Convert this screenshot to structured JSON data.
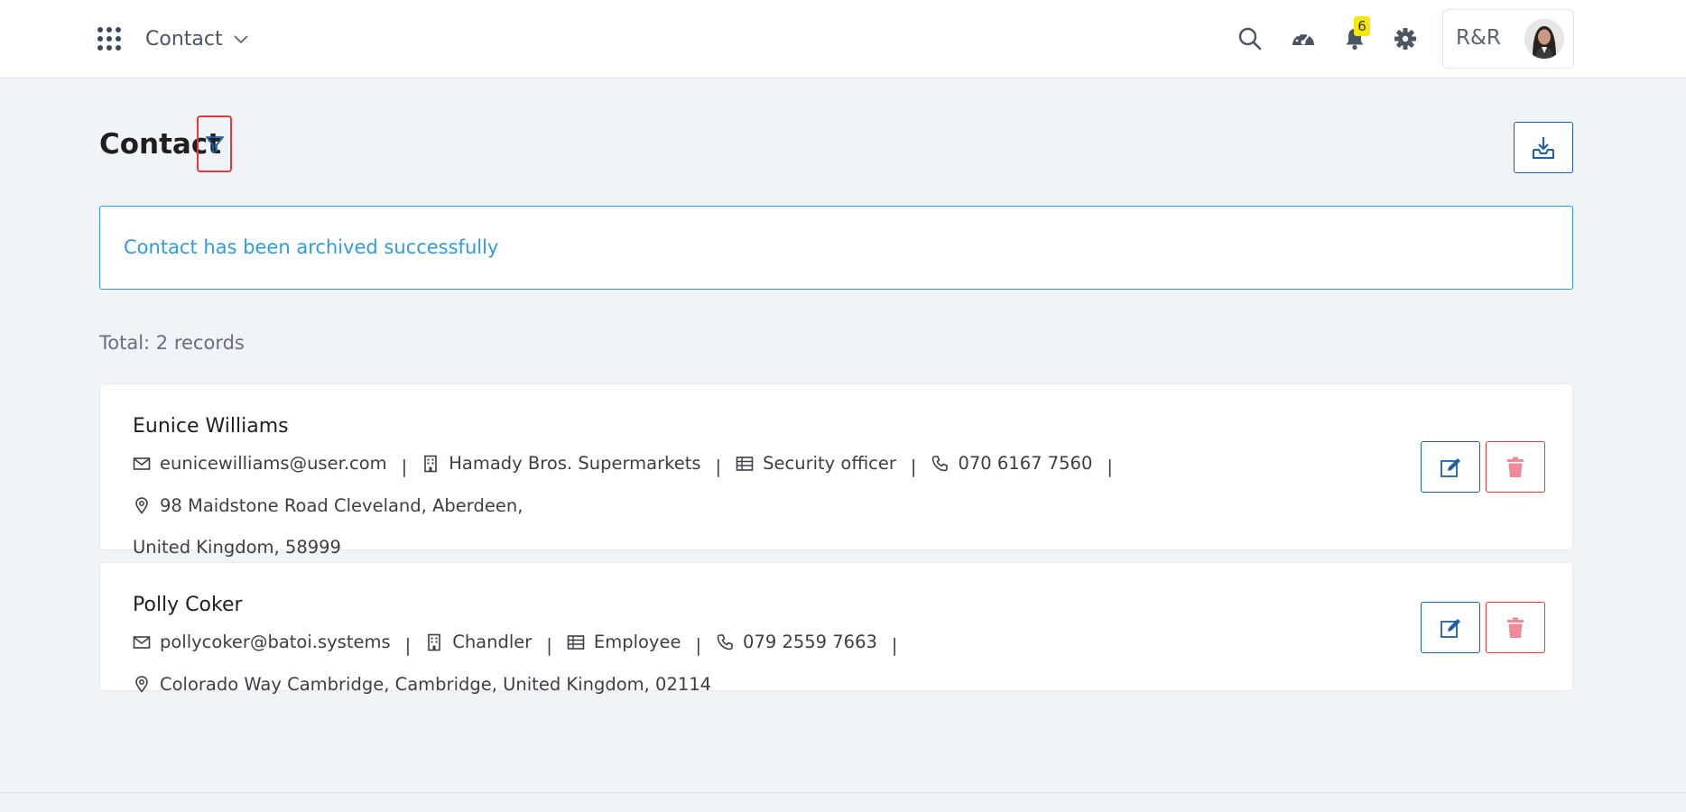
{
  "header": {
    "module_label": "Contact",
    "notification_count": "6",
    "org_label": "R&R"
  },
  "page": {
    "title": "Contact"
  },
  "alert": {
    "message": "Contact has been archived successfully"
  },
  "total_label": "Total: 2 records",
  "contacts": [
    {
      "name": "Eunice Williams",
      "email": "eunicewilliams@user.com",
      "company": "Hamady Bros. Supermarkets",
      "position": "Security officer",
      "phone": "070 6167 7560",
      "address_line1": "98 Maidstone Road Cleveland, Aberdeen,",
      "address_line2": "United Kingdom, 58999"
    },
    {
      "name": "Polly Coker",
      "email": "pollycoker@batoi.systems",
      "company": "Chandler",
      "position": "Employee",
      "phone": "079 2559 7663",
      "address": "Colorado Way Cambridge, Cambridge, United Kingdom, 02114"
    }
  ],
  "separator": "|",
  "icons": {
    "apps": "grid-icon",
    "chevron": "chevron-down-icon",
    "search": "search-icon",
    "dashboard": "speedometer-icon",
    "notifications": "bell-icon",
    "settings": "gear-icon",
    "filter": "filter-icon",
    "export": "download-tray-icon",
    "email": "envelope-icon",
    "company": "building-icon",
    "position": "table-icon",
    "phone": "phone-icon",
    "address": "map-pin-icon",
    "edit": "pencil-square-icon",
    "delete": "trash-icon"
  },
  "colors": {
    "accent": "#1e5fa8",
    "info": "#2f9be0",
    "danger": "#e23a3a",
    "badge": "#f5e60b",
    "background": "#f0f3f8"
  }
}
